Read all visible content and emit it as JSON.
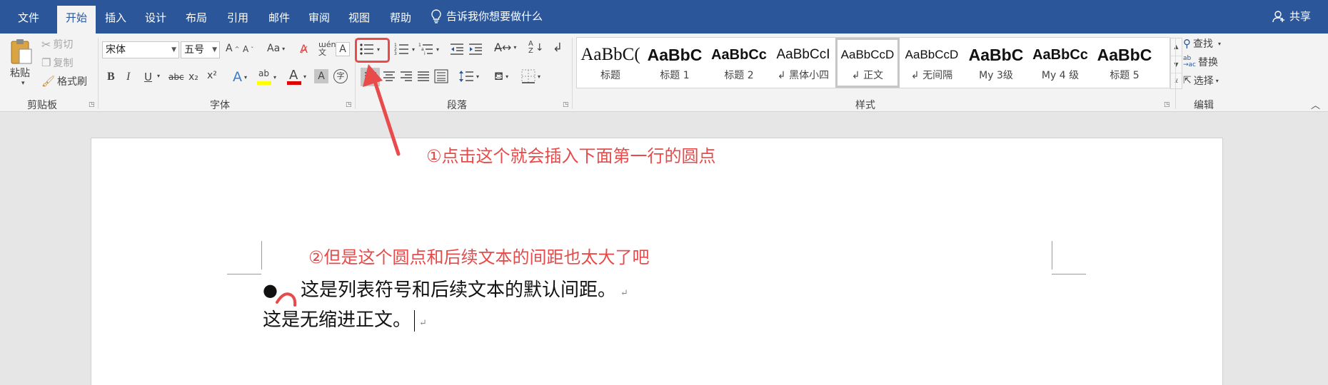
{
  "tabs": [
    "文件",
    "开始",
    "插入",
    "设计",
    "布局",
    "引用",
    "邮件",
    "审阅",
    "视图",
    "帮助"
  ],
  "active_tab": "开始",
  "tell_me": "告诉我你想要做什么",
  "share": "共享",
  "clipboard": {
    "paste": "粘贴",
    "cut": "剪切",
    "copy": "复制",
    "format_painter": "格式刷",
    "group_label": "剪贴板"
  },
  "font": {
    "font_name": "宋体",
    "font_size": "五号",
    "group_label": "字体",
    "case_label": "Aa",
    "bold": "B",
    "italic": "I",
    "underline": "U",
    "strike": "abc",
    "subscript": "x₂",
    "superscript": "x²"
  },
  "paragraph": {
    "group_label": "段落"
  },
  "styles": {
    "group_label": "样式",
    "items": [
      {
        "preview": "AaBbC(",
        "name": "标题"
      },
      {
        "preview": "AaBbC",
        "name": "标题 1"
      },
      {
        "preview": "AaBbCc",
        "name": "标题 2"
      },
      {
        "preview": "AaBbCcI",
        "name": "↲ 黑体小四"
      },
      {
        "preview": "AaBbCcD",
        "name": "↲ 正文"
      },
      {
        "preview": "AaBbCcD",
        "name": "↲ 无间隔"
      },
      {
        "preview": "AaBbC",
        "name": "My 3级"
      },
      {
        "preview": "AaBbCc",
        "name": "My 4 级"
      },
      {
        "preview": "AaBbC",
        "name": "标题 5"
      }
    ]
  },
  "editing": {
    "find": "查找",
    "replace": "替换",
    "select": "选择",
    "group_label": "编辑"
  },
  "annotations": {
    "note1": "①点击这个就会插入下面第一行的圆点",
    "note2": "②但是这个圆点和后续文本的间距也太大了吧"
  },
  "document": {
    "bullet": "●",
    "line1": "这是列表符号和后续文本的默认间距。",
    "line2": "这是无缩进正文。",
    "para_mark": "↵"
  },
  "colors": {
    "tab_bar": "#2b579a",
    "annotation_red": "#e84a4a",
    "highlight_yellow": "#ffff00",
    "font_color_red": "#e00000"
  }
}
